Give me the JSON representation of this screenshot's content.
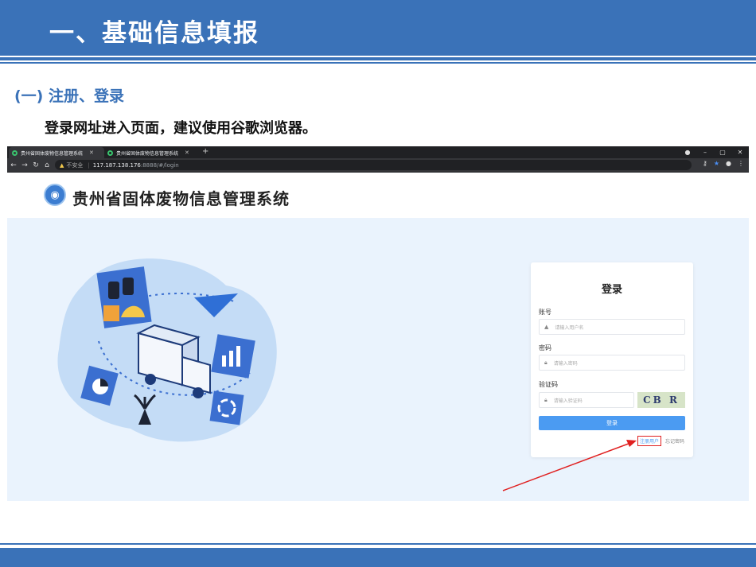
{
  "slide": {
    "header_title": "一、基础信息填报",
    "section_title": "(一) 注册、登录",
    "note": "登录网址进入页面，建议使用谷歌浏览器。"
  },
  "browser": {
    "tabs": [
      {
        "label": "贵州省固体废物信息管理系统"
      },
      {
        "label": "贵州省固体废物信息管理系统"
      }
    ],
    "address": {
      "security_label": "不安全",
      "host": "117.187.138.176",
      "path": ":8888/#/login"
    }
  },
  "app": {
    "title": "贵州省固体废物信息管理系统"
  },
  "login": {
    "title": "登录",
    "account_label": "账号",
    "account_placeholder": "请输入用户名",
    "password_label": "密码",
    "password_placeholder": "请输入密码",
    "captcha_label": "验证码",
    "captcha_placeholder": "请输入验证码",
    "captcha_text": "CB R",
    "login_button": "登录",
    "register_link": "注册用户",
    "forgot_link": "忘记密码"
  },
  "colors": {
    "brand_blue": "#3a72b8",
    "button_blue": "#4b9bf2",
    "highlight_red": "#e02020"
  }
}
